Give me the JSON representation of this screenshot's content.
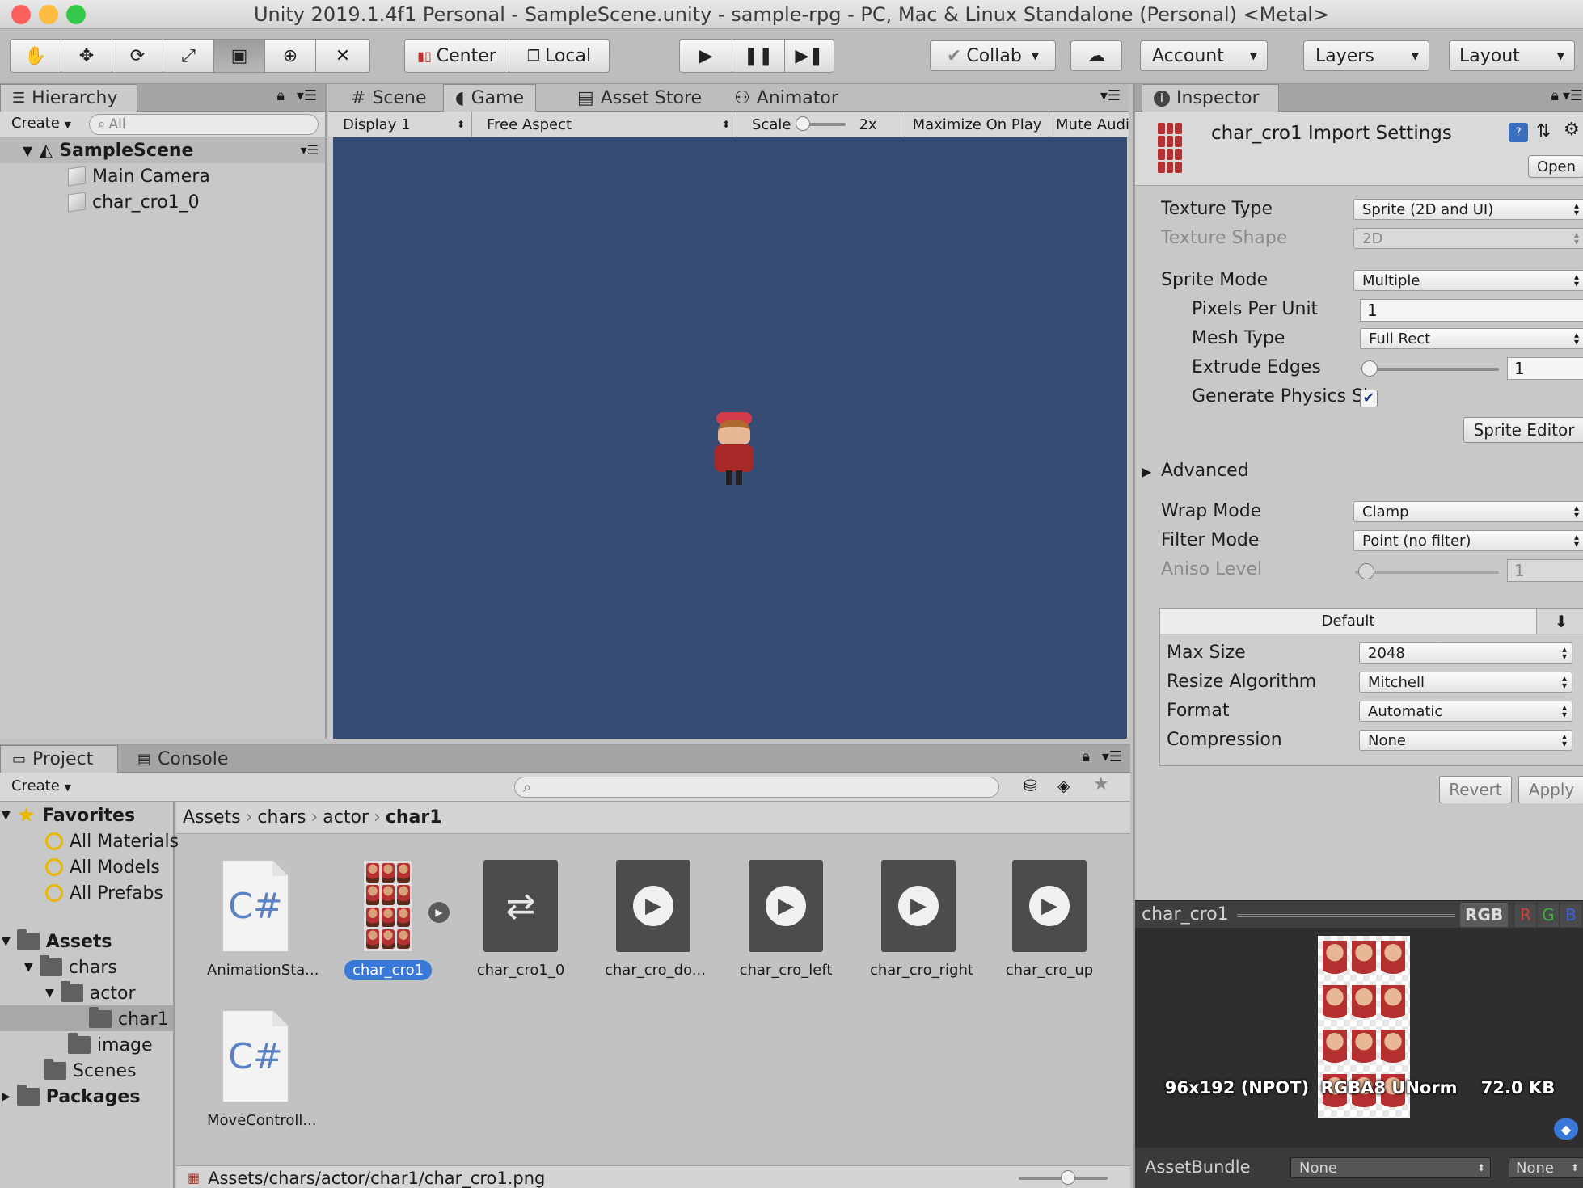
{
  "window": {
    "title": "Unity 2019.1.4f1 Personal - SampleScene.unity - sample-rpg - PC, Mac & Linux Standalone (Personal) <Metal>"
  },
  "toolbar": {
    "pivot_label": "Center",
    "space_label": "Local",
    "collab_label": "Collab",
    "account_label": "Account",
    "layers_label": "Layers",
    "layout_label": "Layout"
  },
  "hierarchy": {
    "tab_label": "Hierarchy",
    "create_label": "Create",
    "search_placeholder": "All",
    "scene_name": "SampleScene",
    "items": [
      "Main Camera",
      "char_cro1_0"
    ]
  },
  "center_tabs": {
    "scene": "Scene",
    "game": "Game",
    "asset_store": "Asset Store",
    "animator": "Animator"
  },
  "game_bar": {
    "display": "Display 1",
    "aspect": "Free Aspect",
    "scale_label": "Scale",
    "scale_value": "2x",
    "maximize": "Maximize On Play",
    "mute": "Mute Audio"
  },
  "game_view": {
    "background": "#354c74"
  },
  "inspector": {
    "tab_label": "Inspector",
    "header_title": "char_cro1 Import Settings",
    "open_label": "Open",
    "rows": {
      "texture_type": {
        "label": "Texture Type",
        "value": "Sprite (2D and UI)"
      },
      "texture_shape": {
        "label": "Texture Shape",
        "value": "2D"
      },
      "sprite_mode": {
        "label": "Sprite Mode",
        "value": "Multiple"
      },
      "pixels_per_unit": {
        "label": "Pixels Per Unit",
        "value": "1"
      },
      "mesh_type": {
        "label": "Mesh Type",
        "value": "Full Rect"
      },
      "extrude_edges": {
        "label": "Extrude Edges",
        "value": "1"
      },
      "generate_physics": {
        "label": "Generate Physics Sh"
      },
      "advanced": {
        "label": "Advanced"
      },
      "wrap_mode": {
        "label": "Wrap Mode",
        "value": "Clamp"
      },
      "filter_mode": {
        "label": "Filter Mode",
        "value": "Point (no filter)"
      },
      "aniso_level": {
        "label": "Aniso Level",
        "value": "1"
      }
    },
    "sprite_editor_label": "Sprite Editor",
    "platform": {
      "tab_label": "Default",
      "max_size": {
        "label": "Max Size",
        "value": "2048"
      },
      "resize_algorithm": {
        "label": "Resize Algorithm",
        "value": "Mitchell"
      },
      "format": {
        "label": "Format",
        "value": "Automatic"
      },
      "compression": {
        "label": "Compression",
        "value": "None"
      }
    },
    "revert_label": "Revert",
    "apply_label": "Apply",
    "preview": {
      "name": "char_cro1",
      "channels": [
        "RGB",
        "R",
        "G",
        "B"
      ],
      "info": "96x192 (NPOT)  RGBA8 UNorm    72.0 KB"
    },
    "asset_bundle": {
      "label": "AssetBundle",
      "value": "None",
      "variant": "None"
    }
  },
  "project": {
    "tab_label": "Project",
    "console_label": "Console",
    "create_label": "Create",
    "favorites": {
      "label": "Favorites",
      "items": [
        "All Materials",
        "All Models",
        "All Prefabs"
      ]
    },
    "assets_label": "Assets",
    "tree": {
      "chars": "chars",
      "actor": "actor",
      "char1": "char1",
      "image": "image",
      "scenes": "Scenes"
    },
    "packages_label": "Packages",
    "breadcrumb": [
      "Assets",
      "chars",
      "actor",
      "char1"
    ],
    "assets": [
      {
        "name": "AnimationSta...",
        "kind": "script"
      },
      {
        "name": "char_cro1",
        "kind": "sprite",
        "selected": true
      },
      {
        "name": "char_cro1_0",
        "kind": "controller"
      },
      {
        "name": "char_cro_do...",
        "kind": "anim"
      },
      {
        "name": "char_cro_left",
        "kind": "anim"
      },
      {
        "name": "char_cro_right",
        "kind": "anim"
      },
      {
        "name": "char_cro_up",
        "kind": "anim"
      },
      {
        "name": "MoveControll...",
        "kind": "script"
      }
    ],
    "status_path": "Assets/chars/actor/char1/char_cro1.png"
  }
}
